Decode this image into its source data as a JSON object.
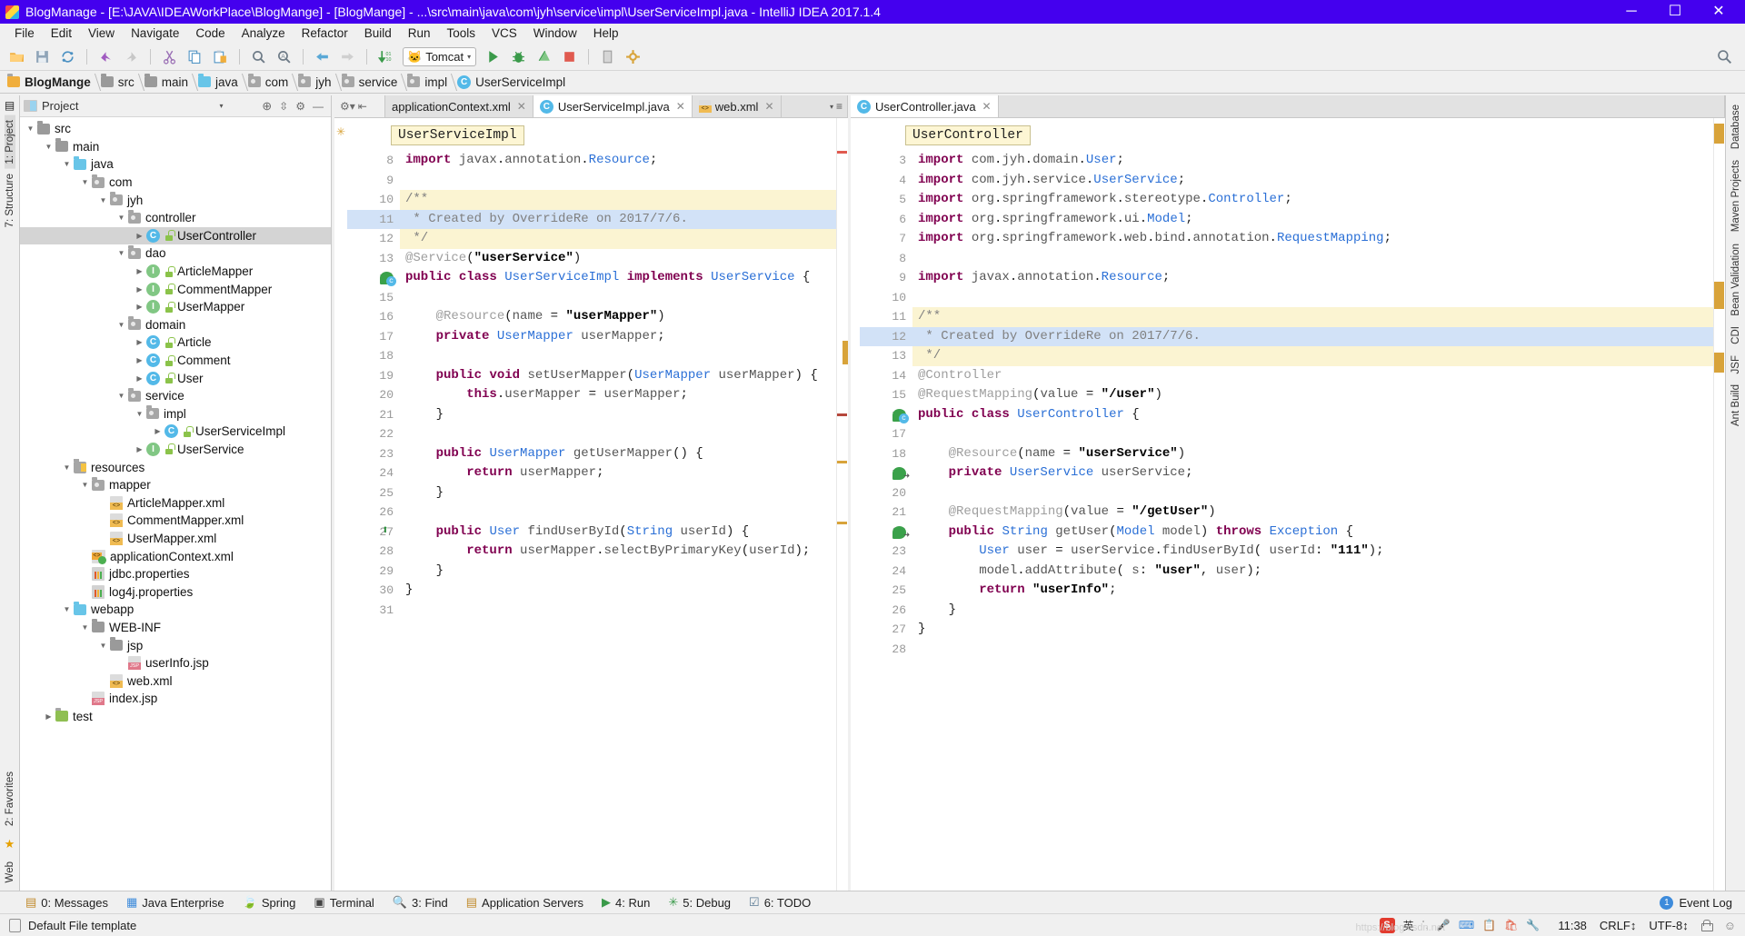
{
  "window": {
    "title": "BlogManage - [E:\\JAVA\\IDEAWorkPlace\\BlogMange] - [BlogMange] - ...\\src\\main\\java\\com\\jyh\\service\\impl\\UserServiceImpl.java - IntelliJ IDEA 2017.1.4",
    "minimize": "─",
    "maximize": "☐",
    "close": "✕",
    "titlebar_color": "#4400ee"
  },
  "menu": [
    {
      "label": "File"
    },
    {
      "label": "Edit"
    },
    {
      "label": "View"
    },
    {
      "label": "Navigate"
    },
    {
      "label": "Code"
    },
    {
      "label": "Analyze"
    },
    {
      "label": "Refactor"
    },
    {
      "label": "Build"
    },
    {
      "label": "Run"
    },
    {
      "label": "Tools"
    },
    {
      "label": "VCS"
    },
    {
      "label": "Window"
    },
    {
      "label": "Help"
    }
  ],
  "toolbar": {
    "icons": [
      "open-folder-icon",
      "save-all-icon",
      "sync-icon",
      "sep",
      "undo-icon",
      "redo-icon",
      "sep",
      "cut-icon",
      "copy-icon",
      "paste-icon",
      "sep",
      "find-icon",
      "replace-icon",
      "sep",
      "back-icon",
      "forward-icon",
      "sep",
      "compile-icon"
    ],
    "run_config": {
      "label": "Tomcat",
      "icon": "tomcat-cat-icon",
      "caret": "▾"
    },
    "run_icons": [
      "run-icon",
      "debug-icon",
      "coverage-icon",
      "stop-icon",
      "sep",
      "exit-icon",
      "settings-icon"
    ],
    "search_icon": "search-everywhere-icon"
  },
  "breadcrumb": [
    {
      "label": "BlogMange",
      "icon": "folder-orange-icon",
      "bold": true
    },
    {
      "label": "src",
      "icon": "folder-icon"
    },
    {
      "label": "main",
      "icon": "folder-icon"
    },
    {
      "label": "java",
      "icon": "folder-blue-icon"
    },
    {
      "label": "com",
      "icon": "package-icon"
    },
    {
      "label": "jyh",
      "icon": "package-icon"
    },
    {
      "label": "service",
      "icon": "package-icon"
    },
    {
      "label": "impl",
      "icon": "package-icon"
    },
    {
      "label": "UserServiceImpl",
      "icon": "class-icon"
    }
  ],
  "left_rail": {
    "items": [
      "1: Project",
      "7: Structure"
    ],
    "bottom_items": [
      "2: Favorites",
      "Web"
    ]
  },
  "right_rail": {
    "items": [
      "Database",
      "Maven Projects",
      "Bean Validation",
      "CDI",
      "JSF",
      "Ant Build"
    ]
  },
  "project_panel": {
    "title": "Project",
    "caret": "▾",
    "actions": [
      "target-icon",
      "collapse-all-icon",
      "settings-gear-icon",
      "hide-icon"
    ],
    "tree": [
      {
        "indent": 1,
        "arrow": "down",
        "icon": "folder-src-icon",
        "label": "src",
        "selected": false
      },
      {
        "indent": 2,
        "arrow": "down",
        "icon": "folder-src-icon",
        "label": "main",
        "selected": false
      },
      {
        "indent": 3,
        "arrow": "down",
        "icon": "folder-blue-icon",
        "label": "java",
        "selected": false
      },
      {
        "indent": 4,
        "arrow": "down",
        "icon": "package-icon",
        "label": "com",
        "selected": false
      },
      {
        "indent": 5,
        "arrow": "down",
        "icon": "package-icon",
        "label": "jyh",
        "selected": false
      },
      {
        "indent": 6,
        "arrow": "down",
        "icon": "package-icon",
        "label": "controller",
        "selected": false
      },
      {
        "indent": 7,
        "arrow": "right",
        "icon": "class-icon",
        "label": "UserController",
        "selected": true
      },
      {
        "indent": 6,
        "arrow": "down",
        "icon": "package-icon",
        "label": "dao",
        "selected": false
      },
      {
        "indent": 7,
        "arrow": "right",
        "icon": "interface-icon",
        "label": "ArticleMapper",
        "selected": false
      },
      {
        "indent": 7,
        "arrow": "right",
        "icon": "interface-icon",
        "label": "CommentMapper",
        "selected": false
      },
      {
        "indent": 7,
        "arrow": "right",
        "icon": "interface-icon",
        "label": "UserMapper",
        "selected": false
      },
      {
        "indent": 6,
        "arrow": "down",
        "icon": "package-icon",
        "label": "domain",
        "selected": false
      },
      {
        "indent": 7,
        "arrow": "right",
        "icon": "class-icon",
        "label": "Article",
        "selected": false
      },
      {
        "indent": 7,
        "arrow": "right",
        "icon": "class-icon",
        "label": "Comment",
        "selected": false
      },
      {
        "indent": 7,
        "arrow": "right",
        "icon": "class-icon",
        "label": "User",
        "selected": false
      },
      {
        "indent": 6,
        "arrow": "down",
        "icon": "package-icon",
        "label": "service",
        "selected": false
      },
      {
        "indent": 7,
        "arrow": "down",
        "icon": "package-icon",
        "label": "impl",
        "selected": false
      },
      {
        "indent": 8,
        "arrow": "right",
        "icon": "class-icon",
        "label": "UserServiceImpl",
        "selected": false
      },
      {
        "indent": 7,
        "arrow": "right",
        "icon": "interface-icon",
        "label": "UserService",
        "selected": false
      },
      {
        "indent": 3,
        "arrow": "down",
        "icon": "resources-icon",
        "label": "resources",
        "selected": false
      },
      {
        "indent": 4,
        "arrow": "down",
        "icon": "package-icon",
        "label": "mapper",
        "selected": false
      },
      {
        "indent": 5,
        "arrow": "none",
        "icon": "xml-icon",
        "label": "ArticleMapper.xml",
        "selected": false
      },
      {
        "indent": 5,
        "arrow": "none",
        "icon": "xml-icon",
        "label": "CommentMapper.xml",
        "selected": false
      },
      {
        "indent": 5,
        "arrow": "none",
        "icon": "xml-icon",
        "label": "UserMapper.xml",
        "selected": false
      },
      {
        "indent": 4,
        "arrow": "none",
        "icon": "spring-xml-icon",
        "label": "applicationContext.xml",
        "selected": false
      },
      {
        "indent": 4,
        "arrow": "none",
        "icon": "properties-icon",
        "label": "jdbc.properties",
        "selected": false
      },
      {
        "indent": 4,
        "arrow": "none",
        "icon": "properties-icon",
        "label": "log4j.properties",
        "selected": false
      },
      {
        "indent": 3,
        "arrow": "down",
        "icon": "folder-web-icon",
        "label": "webapp",
        "selected": false
      },
      {
        "indent": 4,
        "arrow": "down",
        "icon": "folder-src-icon",
        "label": "WEB-INF",
        "selected": false
      },
      {
        "indent": 5,
        "arrow": "down",
        "icon": "folder-src-icon",
        "label": "jsp",
        "selected": false
      },
      {
        "indent": 6,
        "arrow": "none",
        "icon": "jsp-icon",
        "label": "userInfo.jsp",
        "selected": false
      },
      {
        "indent": 5,
        "arrow": "none",
        "icon": "xml-web-icon",
        "label": "web.xml",
        "selected": false
      },
      {
        "indent": 4,
        "arrow": "none",
        "icon": "jsp-icon",
        "label": "index.jsp",
        "selected": false
      },
      {
        "indent": 2,
        "arrow": "right",
        "icon": "folder-test-icon",
        "label": "test",
        "selected": false
      }
    ]
  },
  "editor_left": {
    "tabs": [
      {
        "label": "applicationContext.xml",
        "icon": "spring-xml-icon",
        "active": false,
        "close": "✕"
      },
      {
        "label": "UserServiceImpl.java",
        "icon": "class-icon",
        "active": true,
        "close": "✕"
      },
      {
        "label": "web.xml",
        "icon": "xml-web-icon",
        "active": false,
        "close": "✕"
      }
    ],
    "tab_actions": [
      "sort-caret-icon",
      "tab-list-icon"
    ],
    "sticky_chip": "UserServiceImpl",
    "caret_line": 11,
    "first_line": 8,
    "lines": [
      {
        "n": 8,
        "text": "import javax.annotation.Resource;"
      },
      {
        "n": 9,
        "text": ""
      },
      {
        "n": 10,
        "text": "/**"
      },
      {
        "n": 11,
        "text": " * Created by OverrideRe on 2017/7/6."
      },
      {
        "n": 12,
        "text": " */"
      },
      {
        "n": 13,
        "text": "@Service(\"userService\")"
      },
      {
        "n": 14,
        "text": "public class UserServiceImpl implements UserService {"
      },
      {
        "n": 15,
        "text": ""
      },
      {
        "n": 16,
        "text": "    @Resource(name = \"userMapper\")"
      },
      {
        "n": 17,
        "text": "    private UserMapper userMapper;"
      },
      {
        "n": 18,
        "text": ""
      },
      {
        "n": 19,
        "text": "    public void setUserMapper(UserMapper userMapper) {"
      },
      {
        "n": 20,
        "text": "        this.userMapper = userMapper;"
      },
      {
        "n": 21,
        "text": "    }"
      },
      {
        "n": 22,
        "text": ""
      },
      {
        "n": 23,
        "text": "    public UserMapper getUserMapper() {"
      },
      {
        "n": 24,
        "text": "        return userMapper;"
      },
      {
        "n": 25,
        "text": "    }"
      },
      {
        "n": 26,
        "text": ""
      },
      {
        "n": 27,
        "text": "    public User findUserById(String userId) {"
      },
      {
        "n": 28,
        "text": "        return userMapper.selectByPrimaryKey(userId);"
      },
      {
        "n": 29,
        "text": "    }"
      },
      {
        "n": 30,
        "text": "}"
      },
      {
        "n": 31,
        "text": ""
      }
    ],
    "comment_block": {
      "start": 10,
      "end": 12
    }
  },
  "editor_right": {
    "tabs": [
      {
        "label": "UserController.java",
        "icon": "class-icon",
        "active": true,
        "close": "✕"
      }
    ],
    "sticky_chip": "UserController",
    "caret_line": 12,
    "first_line": 3,
    "lines": [
      {
        "n": 3,
        "text": "import com.jyh.domain.User;"
      },
      {
        "n": 4,
        "text": "import com.jyh.service.UserService;"
      },
      {
        "n": 5,
        "text": "import org.springframework.stereotype.Controller;"
      },
      {
        "n": 6,
        "text": "import org.springframework.ui.Model;"
      },
      {
        "n": 7,
        "text": "import org.springframework.web.bind.annotation.RequestMapping;"
      },
      {
        "n": 8,
        "text": ""
      },
      {
        "n": 9,
        "text": "import javax.annotation.Resource;"
      },
      {
        "n": 10,
        "text": ""
      },
      {
        "n": 11,
        "text": "/**"
      },
      {
        "n": 12,
        "text": " * Created by OverrideRe on 2017/7/6."
      },
      {
        "n": 13,
        "text": " */"
      },
      {
        "n": 14,
        "text": "@Controller"
      },
      {
        "n": 15,
        "text": "@RequestMapping(value = \"/user\")"
      },
      {
        "n": 16,
        "text": "public class UserController {"
      },
      {
        "n": 17,
        "text": ""
      },
      {
        "n": 18,
        "text": "    @Resource(name = \"userService\")"
      },
      {
        "n": 19,
        "text": "    private UserService userService;"
      },
      {
        "n": 20,
        "text": ""
      },
      {
        "n": 21,
        "text": "    @RequestMapping(value = \"/getUser\")"
      },
      {
        "n": 22,
        "text": "    public String getUser(Model model) throws Exception {"
      },
      {
        "n": 23,
        "text": "        User user = userService.findUserById( userId: \"111\");"
      },
      {
        "n": 24,
        "text": "        model.addAttribute( s: \"user\", user);"
      },
      {
        "n": 25,
        "text": "        return \"userInfo\";"
      },
      {
        "n": 26,
        "text": "    }"
      },
      {
        "n": 27,
        "text": "}"
      },
      {
        "n": 28,
        "text": ""
      }
    ],
    "comment_block": {
      "start": 11,
      "end": 13
    },
    "error_icon": "error-circle-icon"
  },
  "bottom_bar": {
    "items": [
      {
        "label": "0: Messages",
        "mnemonic": "0",
        "icon": "messages-icon"
      },
      {
        "label": "Java Enterprise",
        "mnemonic": "",
        "icon": "java-ee-icon"
      },
      {
        "label": "Spring",
        "mnemonic": "",
        "icon": "spring-leaf-icon"
      },
      {
        "label": "Terminal",
        "mnemonic": "",
        "icon": "terminal-icon"
      },
      {
        "label": "3: Find",
        "mnemonic": "3",
        "icon": "find-icon"
      },
      {
        "label": "Application Servers",
        "mnemonic": "",
        "icon": "app-servers-icon"
      },
      {
        "label": "4: Run",
        "mnemonic": "4",
        "icon": "run-icon"
      },
      {
        "label": "5: Debug",
        "mnemonic": "5",
        "icon": "debug-icon"
      },
      {
        "label": "6: TODO",
        "mnemonic": "6",
        "icon": "todo-icon"
      }
    ],
    "event_log": {
      "label": "Event Log",
      "badge": "1"
    }
  },
  "status_bar": {
    "message": "Default File template",
    "icon": "file-template-icon",
    "ime": {
      "logo": "S",
      "mode": "英",
      "punct": "˙,",
      "icons": [
        "mic-icon",
        "keyboard-icon",
        "clipboard-icon",
        "shopping-icon",
        "tools-icon"
      ]
    },
    "time": "11:38",
    "line_sep": "CRLF↕",
    "encoding": "UTF-8↕",
    "lock_icon": "read-only-lock-icon",
    "watermark": "https://blog.csdn.net"
  }
}
